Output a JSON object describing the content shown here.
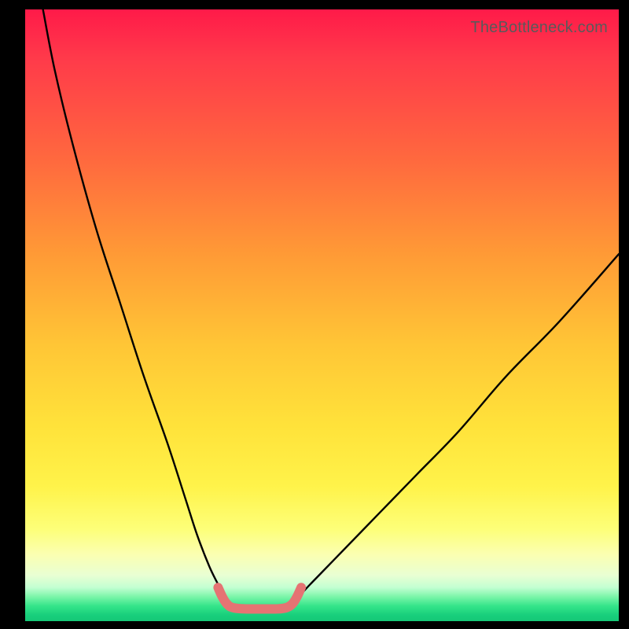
{
  "watermark": "TheBottleneck.com",
  "chart_data": {
    "type": "line",
    "title": "",
    "xlabel": "",
    "ylabel": "",
    "xlim": [
      0,
      100
    ],
    "ylim": [
      0,
      100
    ],
    "series": [
      {
        "name": "left-curve",
        "x": [
          3,
          5,
          8,
          12,
          16,
          20,
          24,
          27,
          29,
          31,
          32.5,
          33.5,
          34.2
        ],
        "y": [
          100,
          90,
          78,
          64,
          52,
          40,
          29,
          20,
          14,
          9,
          6,
          4,
          3
        ]
      },
      {
        "name": "right-curve",
        "x": [
          44.5,
          46,
          48,
          51,
          55,
          60,
          66,
          73,
          81,
          90,
          100
        ],
        "y": [
          3,
          4,
          6,
          9,
          13,
          18,
          24,
          31,
          40,
          49,
          60
        ]
      },
      {
        "name": "valley-salmon",
        "x": [
          32.5,
          33.2,
          34,
          35,
          37,
          40,
          42.5,
          44,
          45,
          45.8,
          46.5
        ],
        "y": [
          5.5,
          4,
          2.8,
          2.2,
          2,
          2,
          2,
          2.2,
          2.8,
          4,
          5.5
        ]
      }
    ],
    "colors": {
      "curve": "#000000",
      "valley": "#e57373",
      "gradient_top": "#ff1a49",
      "gradient_mid": "#ffe23a",
      "gradient_bottom": "#15c877"
    }
  }
}
